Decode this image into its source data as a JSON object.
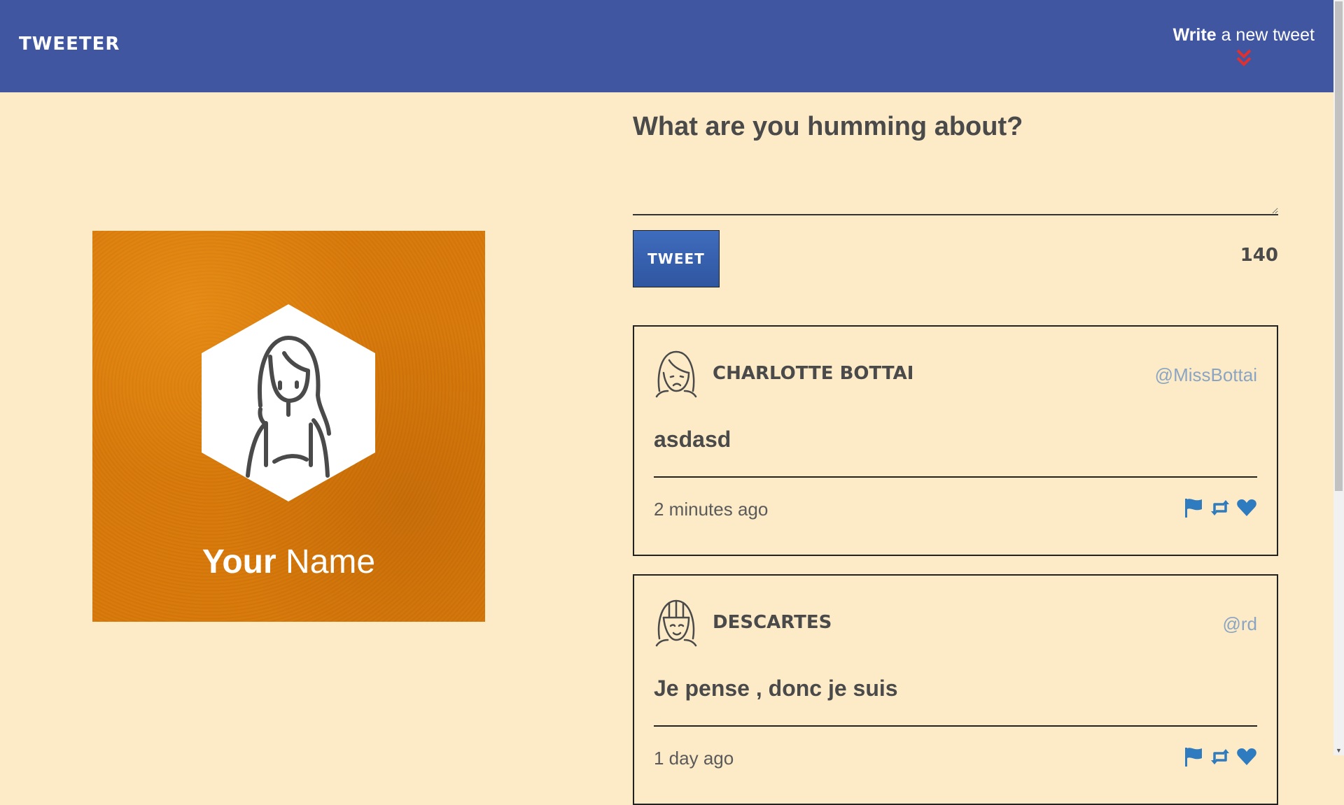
{
  "nav": {
    "brand": "TWEETER",
    "compose_strong": "Write",
    "compose_rest": "a new tweet"
  },
  "profile": {
    "first_name": "Your",
    "last_name": "Name"
  },
  "new_tweet": {
    "heading": "What are you humming about?",
    "textarea_value": "",
    "button_label": "Tweet",
    "char_counter": "140"
  },
  "tweets": [
    {
      "name": "Charlotte Bottai",
      "handle": "@MissBottai",
      "content": "asdasd",
      "time": "2 minutes ago"
    },
    {
      "name": "Descartes",
      "handle": "@rd",
      "content": "Je pense , donc je suis",
      "time": "1 day ago"
    }
  ],
  "colors": {
    "navbar": "#4056a1",
    "background": "#fdebc8",
    "profile_card": "#d97b0c",
    "button": "#3f6cbd",
    "accent_red": "#e03030",
    "icon_blue": "#2f7bbf",
    "handle": "#8aa5c4"
  },
  "icons": {
    "compose_toggle": "double-chevron-down-icon",
    "flag": "flag-icon",
    "retweet": "retweet-icon",
    "like": "heart-icon"
  }
}
